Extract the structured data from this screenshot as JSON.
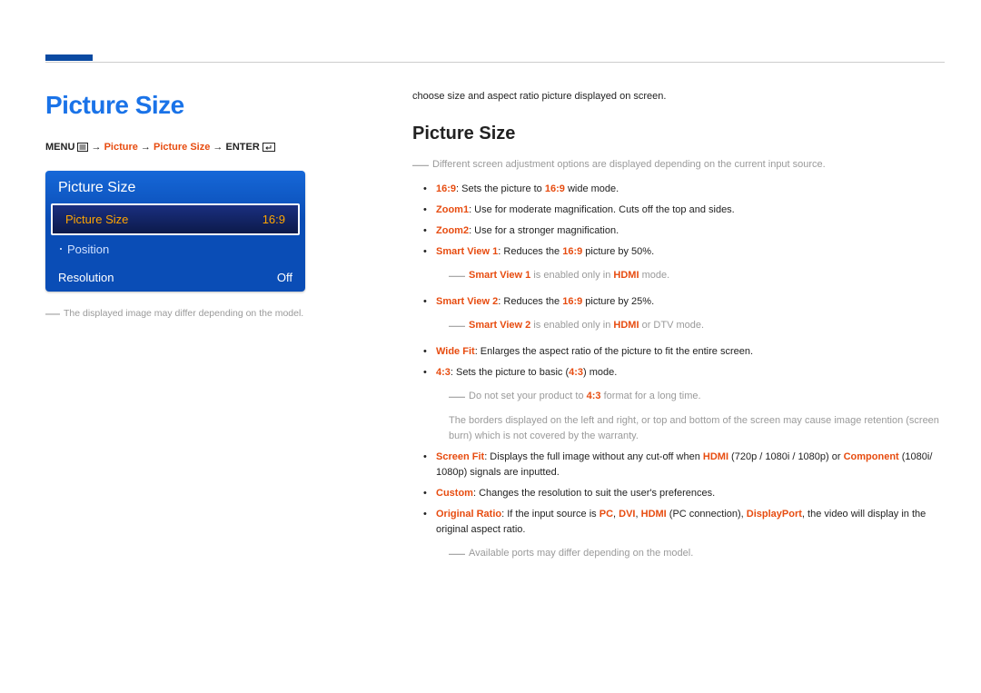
{
  "left": {
    "title": "Picture Size",
    "breadcrumb": {
      "menu": "MENU",
      "picture": "Picture",
      "picture_size": "Picture Size",
      "enter": "ENTER"
    },
    "osd": {
      "panel_title": "Picture Size",
      "rows": [
        {
          "label": "Picture Size",
          "value": "16:9",
          "state": "selected"
        },
        {
          "label": "Position",
          "value": "",
          "state": "muted"
        },
        {
          "label": "Resolution",
          "value": "Off",
          "state": "normal"
        }
      ]
    },
    "disclaimer": "The displayed image may differ depending on the model."
  },
  "right": {
    "intro": "choose size and aspect ratio picture displayed on screen.",
    "heading": "Picture Size",
    "top_note": "Different screen adjustment options are displayed depending on the current input source.",
    "items": {
      "i169_kw": "16:9",
      "i169_rest": ": Sets the picture to ",
      "i169_kw2": "16:9",
      "i169_tail": " wide mode.",
      "zoom1_kw": "Zoom1",
      "zoom1_rest": ": Use for moderate magnification. Cuts off the top and sides.",
      "zoom2_kw": "Zoom2",
      "zoom2_rest": ": Use for a stronger magnification.",
      "sv1_kw": "Smart View 1",
      "sv1_rest_a": ": Reduces the ",
      "sv1_kw2": "16:9",
      "sv1_rest_b": " picture by 50%.",
      "sv1_note_a": "Smart View 1",
      "sv1_note_b": " is enabled only in ",
      "sv1_note_c": "HDMI",
      "sv1_note_d": " mode.",
      "sv2_kw": "Smart View 2",
      "sv2_rest_a": ": Reduces the ",
      "sv2_kw2": "16:9",
      "sv2_rest_b": " picture by 25%.",
      "sv2_note_a": "Smart View 2",
      "sv2_note_b": " is enabled only in ",
      "sv2_note_c": "HDMI",
      "sv2_note_d": " or DTV mode.",
      "wf_kw": "Wide Fit",
      "wf_rest": ": Enlarges the aspect ratio of the picture to fit the entire screen.",
      "r43_kw": "4:3",
      "r43_rest_a": ": Sets the picture to basic (",
      "r43_kw2": "4:3",
      "r43_rest_b": ") mode.",
      "r43_note1_a": "Do not set your product to ",
      "r43_note1_b": "4:3",
      "r43_note1_c": " format for a long time.",
      "r43_note2": "The borders displayed on the left and right, or top and bottom of the screen may cause image retention (screen burn) which is not covered by the warranty.",
      "sf_kw": "Screen Fit",
      "sf_rest_a": ": Displays the full image without any cut-off when ",
      "sf_kw2": "HDMI",
      "sf_rest_b": " (720p / 1080i / 1080p) or ",
      "sf_kw3": "Component",
      "sf_rest_c": " (1080i/ 1080p) signals are inputted.",
      "custom_kw": "Custom",
      "custom_rest": ": Changes the resolution to suit the user's preferences.",
      "or_kw": "Original Ratio",
      "or_rest_a": ": If the input source is ",
      "or_pc": "PC",
      "or_sep1": ", ",
      "or_dvi": "DVI",
      "or_sep2": ", ",
      "or_hdmi": "HDMI",
      "or_rest_b": " (PC connection), ",
      "or_dp": "DisplayPort",
      "or_rest_c": ", the video will display in the original aspect ratio.",
      "or_note": "Available ports may differ depending on the model."
    }
  }
}
